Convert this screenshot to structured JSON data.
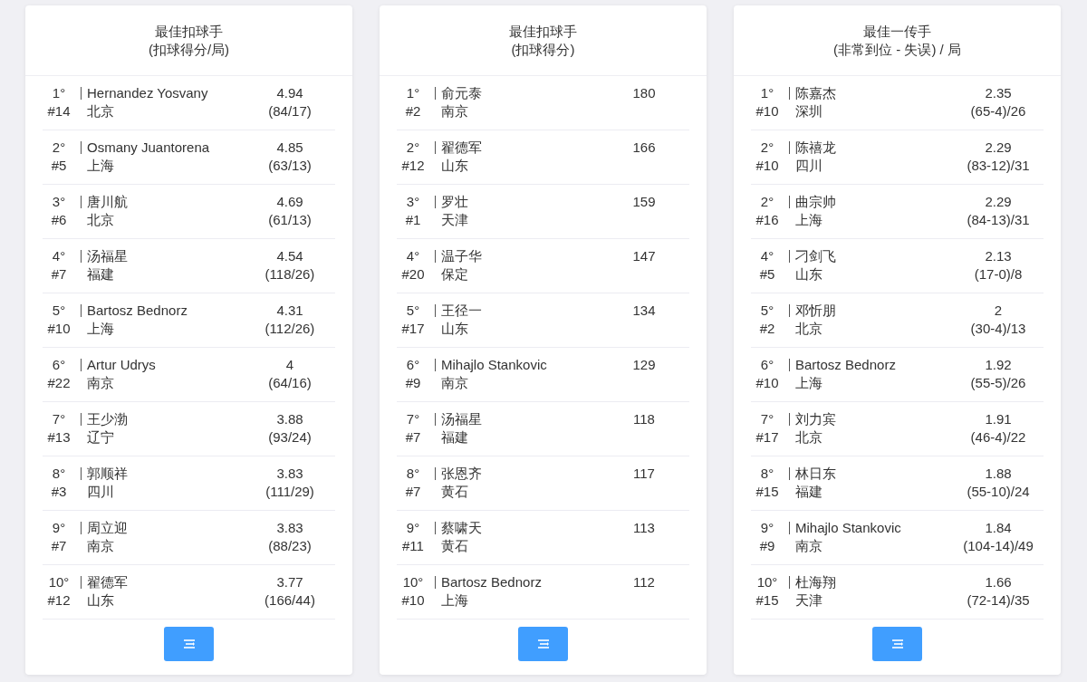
{
  "cards": [
    {
      "title": "最佳扣球手",
      "subtitle": "(扣球得分/局)",
      "rows": [
        {
          "rank": "1°",
          "number": "#14",
          "name": "Hernandez Yosvany",
          "team": "北京",
          "value": "4.94",
          "detail": "(84/17)"
        },
        {
          "rank": "2°",
          "number": "#5",
          "name": "Osmany Juantorena",
          "team": "上海",
          "value": "4.85",
          "detail": "(63/13)"
        },
        {
          "rank": "3°",
          "number": "#6",
          "name": "唐川航",
          "team": "北京",
          "value": "4.69",
          "detail": "(61/13)"
        },
        {
          "rank": "4°",
          "number": "#7",
          "name": "汤福星",
          "team": "福建",
          "value": "4.54",
          "detail": "(118/26)"
        },
        {
          "rank": "5°",
          "number": "#10",
          "name": "Bartosz Bednorz",
          "team": "上海",
          "value": "4.31",
          "detail": "(112/26)"
        },
        {
          "rank": "6°",
          "number": "#22",
          "name": "Artur Udrys",
          "team": "南京",
          "value": "4",
          "detail": "(64/16)"
        },
        {
          "rank": "7°",
          "number": "#13",
          "name": "王少渤",
          "team": "辽宁",
          "value": "3.88",
          "detail": "(93/24)"
        },
        {
          "rank": "8°",
          "number": "#3",
          "name": "郭顺祥",
          "team": "四川",
          "value": "3.83",
          "detail": "(111/29)"
        },
        {
          "rank": "9°",
          "number": "#7",
          "name": "周立迎",
          "team": "南京",
          "value": "3.83",
          "detail": "(88/23)"
        },
        {
          "rank": "10°",
          "number": "#12",
          "name": "翟德军",
          "team": "山东",
          "value": "3.77",
          "detail": "(166/44)"
        }
      ]
    },
    {
      "title": "最佳扣球手",
      "subtitle": "(扣球得分)",
      "rows": [
        {
          "rank": "1°",
          "number": "#2",
          "name": "俞元泰",
          "team": "南京",
          "value": "180"
        },
        {
          "rank": "2°",
          "number": "#12",
          "name": "翟德军",
          "team": "山东",
          "value": "166"
        },
        {
          "rank": "3°",
          "number": "#1",
          "name": "罗壮",
          "team": "天津",
          "value": "159"
        },
        {
          "rank": "4°",
          "number": "#20",
          "name": "温子华",
          "team": "保定",
          "value": "147"
        },
        {
          "rank": "5°",
          "number": "#17",
          "name": "王径一",
          "team": "山东",
          "value": "134"
        },
        {
          "rank": "6°",
          "number": "#9",
          "name": "Mihajlo Stankovic",
          "team": "南京",
          "value": "129"
        },
        {
          "rank": "7°",
          "number": "#7",
          "name": "汤福星",
          "team": "福建",
          "value": "118"
        },
        {
          "rank": "8°",
          "number": "#7",
          "name": "张恩齐",
          "team": "黄石",
          "value": "117"
        },
        {
          "rank": "9°",
          "number": "#11",
          "name": "蔡啸天",
          "team": "黄石",
          "value": "113"
        },
        {
          "rank": "10°",
          "number": "#10",
          "name": "Bartosz Bednorz",
          "team": "上海",
          "value": "112"
        }
      ]
    },
    {
      "title": "最佳一传手",
      "subtitle": "(非常到位 - 失误) / 局",
      "rows": [
        {
          "rank": "1°",
          "number": "#10",
          "name": "陈嘉杰",
          "team": "深圳",
          "value": "2.35",
          "detail": "(65-4)/26"
        },
        {
          "rank": "2°",
          "number": "#10",
          "name": "陈禧龙",
          "team": "四川",
          "value": "2.29",
          "detail": "(83-12)/31"
        },
        {
          "rank": "2°",
          "number": "#16",
          "name": "曲宗帅",
          "team": "上海",
          "value": "2.29",
          "detail": "(84-13)/31"
        },
        {
          "rank": "4°",
          "number": "#5",
          "name": "刁剑飞",
          "team": "山东",
          "value": "2.13",
          "detail": "(17-0)/8"
        },
        {
          "rank": "5°",
          "number": "#2",
          "name": "邓忻朋",
          "team": "北京",
          "value": "2",
          "detail": "(30-4)/13"
        },
        {
          "rank": "6°",
          "number": "#10",
          "name": "Bartosz Bednorz",
          "team": "上海",
          "value": "1.92",
          "detail": "(55-5)/26"
        },
        {
          "rank": "7°",
          "number": "#17",
          "name": "刘力宾",
          "team": "北京",
          "value": "1.91",
          "detail": "(46-4)/22"
        },
        {
          "rank": "8°",
          "number": "#15",
          "name": "林日东",
          "team": "福建",
          "value": "1.88",
          "detail": "(55-10)/24"
        },
        {
          "rank": "9°",
          "number": "#9",
          "name": "Mihajlo Stankovic",
          "team": "南京",
          "value": "1.84",
          "detail": "(104-14)/49"
        },
        {
          "rank": "10°",
          "number": "#15",
          "name": "杜海翔",
          "team": "天津",
          "value": "1.66",
          "detail": "(72-14)/35"
        }
      ]
    }
  ]
}
